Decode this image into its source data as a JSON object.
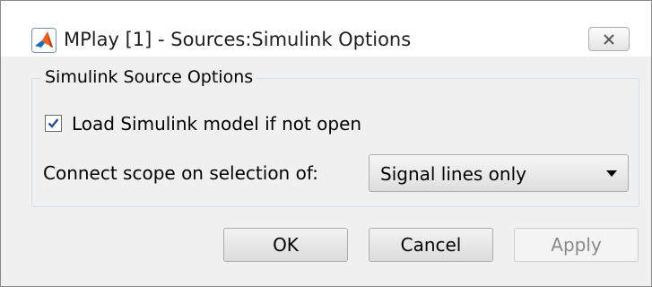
{
  "window": {
    "title": "MPlay [1] - Sources:Simulink Options",
    "app_icon": "matlab-icon",
    "close_icon": "close-icon"
  },
  "group": {
    "legend": "Simulink Source Options"
  },
  "load_model": {
    "checked": true,
    "label": "Load Simulink model if not open"
  },
  "connect_scope": {
    "label": "Connect scope on selection of:",
    "selected": "Signal lines only"
  },
  "buttons": {
    "ok": "OK",
    "cancel": "Cancel",
    "apply": "Apply"
  },
  "colors": {
    "dialog_bg": "#f0f0f0",
    "titlebar_bg": "#ffffff",
    "icon_orange": "#e9611c"
  }
}
